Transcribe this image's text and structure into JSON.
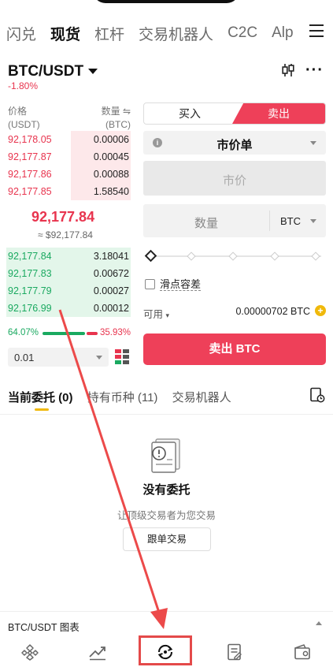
{
  "top_tabs": [
    "闪兑",
    "现货",
    "杠杆",
    "交易机器人",
    "C2C",
    "Alp"
  ],
  "pair": {
    "name": "BTC/USDT",
    "change": "-1.80%"
  },
  "orderbook": {
    "price_header": "价格",
    "price_unit": "(USDT)",
    "qty_header": "数量 ⇋",
    "qty_unit": "(BTC)",
    "asks": [
      {
        "price": "92,178.05",
        "qty": "0.00006",
        "depth": 0.48
      },
      {
        "price": "92,177.87",
        "qty": "0.00045",
        "depth": 0.48
      },
      {
        "price": "92,177.86",
        "qty": "0.00088",
        "depth": 0.48
      },
      {
        "price": "92,177.85",
        "qty": "1.58540",
        "depth": 0.48
      }
    ],
    "last_price": "92,177.84",
    "last_usd": "≈ $92,177.84",
    "bids": [
      {
        "price": "92,177.84",
        "qty": "3.18041",
        "depth": 1.0
      },
      {
        "price": "92,177.83",
        "qty": "0.00672",
        "depth": 1.0
      },
      {
        "price": "92,177.79",
        "qty": "0.00027",
        "depth": 1.0
      },
      {
        "price": "92,176.99",
        "qty": "0.00012",
        "depth": 1.0
      }
    ],
    "buy_ratio": "64.07%",
    "sell_ratio": "35.93%",
    "precision": "0.01"
  },
  "form": {
    "buy_label": "买入",
    "sell_label": "卖出",
    "order_type": "市价单",
    "market_placeholder": "市价",
    "amount_placeholder": "数量",
    "amount_unit": "BTC",
    "slippage_label": "滑点容差",
    "available_label": "可用",
    "available_value": "0.00000702 BTC",
    "submit_label": "卖出 BTC"
  },
  "bottom_tabs": {
    "open_orders": "当前委托 (0)",
    "holdings": "持有币种 (11)",
    "bots": "交易机器人"
  },
  "empty": {
    "title": "没有委托",
    "subtitle": "让顶级交易者为您交易",
    "button": "跟单交易"
  },
  "chart_bar": {
    "label": "BTC/USDT 图表"
  },
  "colors": {
    "red": "#ee4059",
    "green": "#1aa960",
    "yellow": "#f0b90b"
  }
}
